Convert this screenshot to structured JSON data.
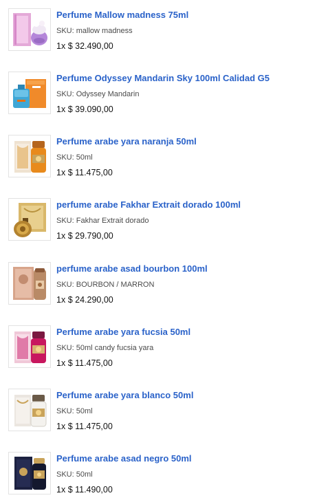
{
  "sku_label": "SKU:",
  "items": [
    {
      "title": "Perfume Mallow madness 75ml",
      "sku": "mallow madness",
      "qty": "1x",
      "price": "$ 32.490,00",
      "image": "purple-perfume-box-icon"
    },
    {
      "title": "Perfume Odyssey Mandarin Sky 100ml Calidad G5",
      "sku": "Odyssey Mandarin",
      "qty": "1x",
      "price": "$ 39.090,00",
      "image": "orange-blue-perfume-icon"
    },
    {
      "title": "Perfume arabe yara naranja 50ml",
      "sku": "50ml",
      "qty": "1x",
      "price": "$ 11.475,00",
      "image": "orange-arabic-perfume-icon"
    },
    {
      "title": "perfume arabe Fakhar Extrait dorado 100ml",
      "sku": "Fakhar Extrait dorado",
      "qty": "1x",
      "price": "$ 29.790,00",
      "image": "gold-round-perfume-icon"
    },
    {
      "title": "perfume arabe asad bourbon 100ml",
      "sku": "BOURBON / MARRON",
      "qty": "1x",
      "price": "$ 24.290,00",
      "image": "brown-perfume-box-icon"
    },
    {
      "title": "Perfume arabe yara fucsia 50ml",
      "sku": "50ml candy fucsia yara",
      "qty": "1x",
      "price": "$ 11.475,00",
      "image": "fuchsia-perfume-icon"
    },
    {
      "title": "Perfume arabe yara blanco 50ml",
      "sku": "50ml",
      "qty": "1x",
      "price": "$ 11.475,00",
      "image": "white-gold-perfume-icon"
    },
    {
      "title": "Perfume arabe asad negro 50ml",
      "sku": "50ml",
      "qty": "1x",
      "price": "$ 11.490,00",
      "image": "black-gold-perfume-icon"
    }
  ]
}
